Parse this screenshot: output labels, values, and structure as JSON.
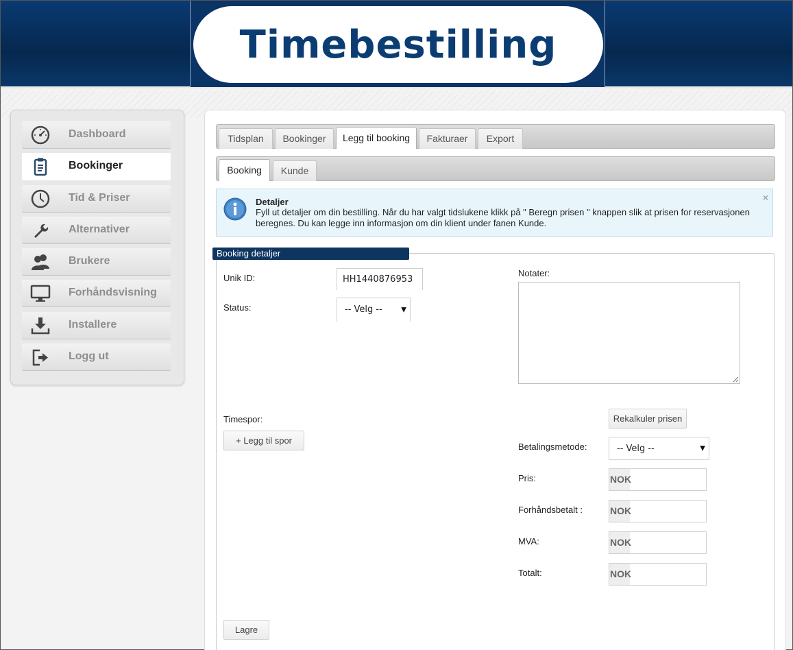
{
  "header": {
    "logo_text": "Timebestilling"
  },
  "sidebar": {
    "items": [
      {
        "label": "Dashboard",
        "icon": "dashboard-icon",
        "active": false
      },
      {
        "label": "Bookinger",
        "icon": "clipboard-icon",
        "active": true
      },
      {
        "label": "Tid & Priser",
        "icon": "clock-icon",
        "active": false
      },
      {
        "label": "Alternativer",
        "icon": "wrench-icon",
        "active": false
      },
      {
        "label": "Brukere",
        "icon": "users-icon",
        "active": false
      },
      {
        "label": "Forhåndsvisning",
        "icon": "monitor-icon",
        "active": false
      },
      {
        "label": "Installere",
        "icon": "download-icon",
        "active": false
      },
      {
        "label": "Logg ut",
        "icon": "logout-icon",
        "active": false
      }
    ]
  },
  "tabs_main": [
    {
      "label": "Tidsplan",
      "active": false
    },
    {
      "label": "Bookinger",
      "active": false
    },
    {
      "label": "Legg til booking",
      "active": true
    },
    {
      "label": "Fakturaer",
      "active": false
    },
    {
      "label": "Export",
      "active": false
    }
  ],
  "tabs_sub": [
    {
      "label": "Booking",
      "active": true
    },
    {
      "label": "Kunde",
      "active": false
    }
  ],
  "info": {
    "title": "Detaljer",
    "text": "Fyll ut detaljer om din bestilling. Når du har valgt tidslukene klikk på \" Beregn prisen \" knappen slik at prisen for reservasjonen beregnes. Du kan legge inn informasjon om din klient under fanen Kunde.",
    "close": "×"
  },
  "form": {
    "legend": "Booking detaljer",
    "unik_id_label": "Unik ID:",
    "unik_id_value": "HH1440876953",
    "status_label": "Status:",
    "status_value": "-- Velg --",
    "notater_label": "Notater:",
    "timespor_label": "Timespor:",
    "add_slot_button": "+ Legg til spor",
    "recalc_button": "Rekalkuler prisen",
    "betalingsmetode_label": "Betalingsmetode:",
    "betalingsmetode_value": "-- Velg --",
    "currency": "NOK",
    "pris_label": "Pris:",
    "forhandsbetalt_label": "Forhåndsbetalt :",
    "mva_label": "MVA:",
    "totalt_label": "Totalt:",
    "save_button": "Lagre"
  },
  "colors": {
    "header_bg": "#0a3a72",
    "logo_text": "#0b3d73",
    "legend_bg": "#0e3560",
    "info_bg": "#e8f6fb"
  }
}
